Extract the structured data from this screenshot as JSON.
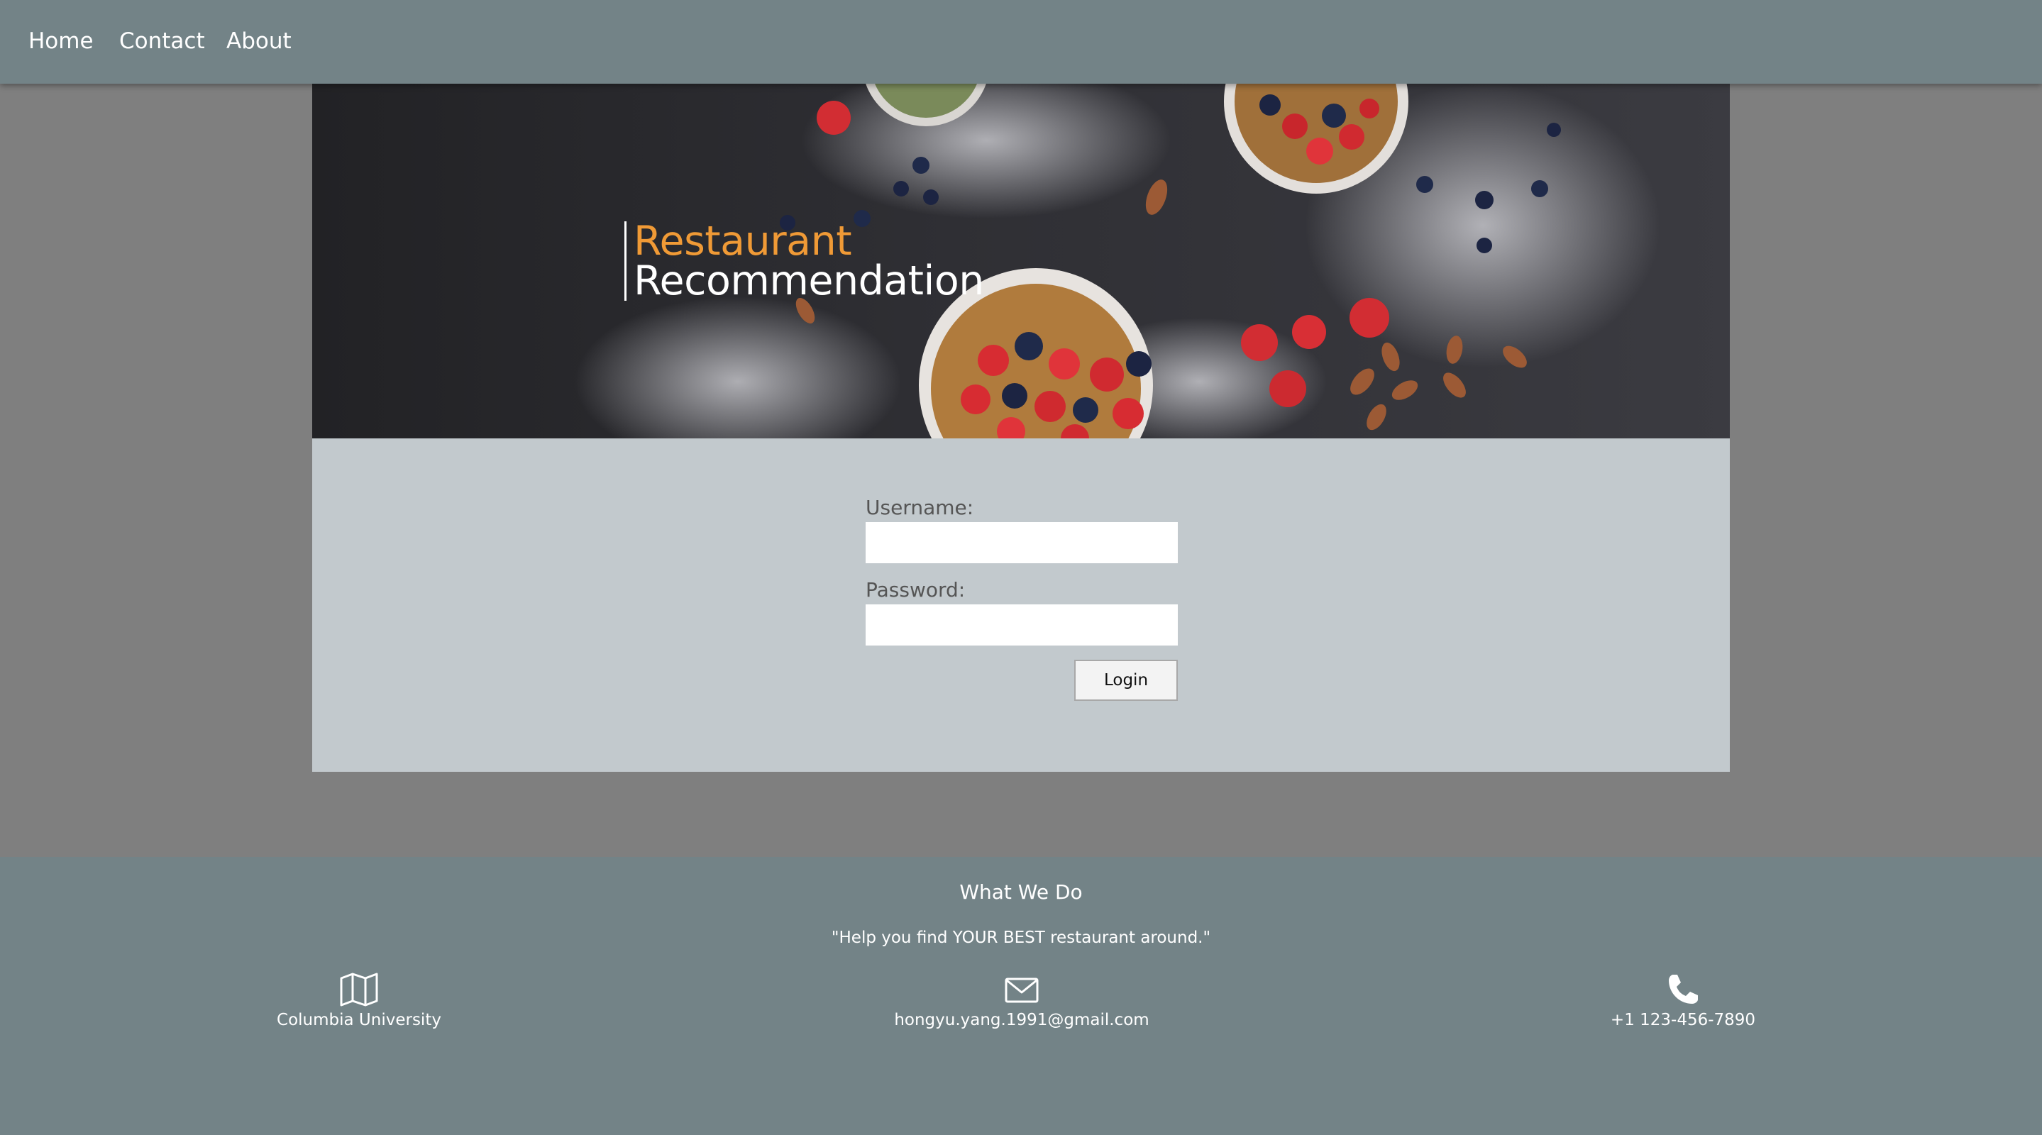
{
  "nav": {
    "items": [
      {
        "label": "Home"
      },
      {
        "label": "Contact"
      },
      {
        "label": "About"
      }
    ]
  },
  "hero": {
    "title_line1": "Restaurant",
    "title_line2": "Recommendation",
    "accent_color": "#f09a36"
  },
  "login": {
    "username_label": "Username:",
    "username_value": "",
    "password_label": "Password:",
    "password_value": "",
    "login_label": "Login"
  },
  "footer": {
    "title": "What We Do",
    "tagline": "\"Help you find YOUR BEST restaurant around.\"",
    "contacts": [
      {
        "icon": "map-icon",
        "text": "Columbia University"
      },
      {
        "icon": "envelope-icon",
        "text": "hongyu.yang.1991@gmail.com"
      },
      {
        "icon": "phone-icon",
        "text": "+1 123-456-7890"
      }
    ]
  },
  "colors": {
    "nav_bg": "#738387",
    "page_bg": "#7f7f7f",
    "panel_bg": "#c2c9cd"
  }
}
